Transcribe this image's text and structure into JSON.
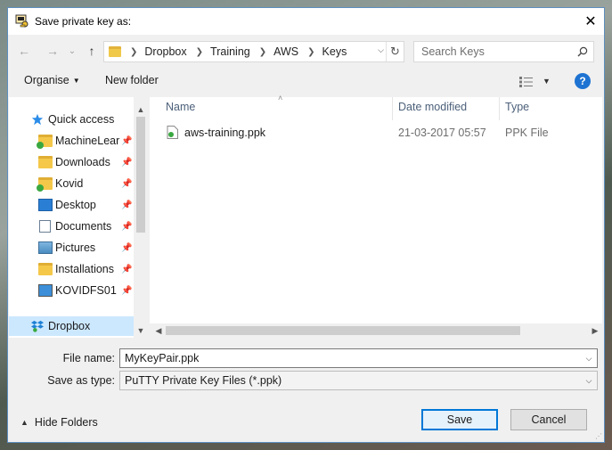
{
  "window": {
    "title": "Save private key as:",
    "close_glyph": "✕"
  },
  "nav": {
    "back_glyph": "←",
    "forward_glyph": "→",
    "recent_glyph": "⌄",
    "up_glyph": "↑",
    "breadcrumb": [
      "Dropbox",
      "Training",
      "AWS",
      "Keys"
    ],
    "search_placeholder": "Search Keys"
  },
  "toolbar": {
    "organise": "Organise",
    "new_folder": "New folder",
    "help": "?"
  },
  "sidebar": {
    "items": [
      {
        "label": "Quick access",
        "icon": "star-icon",
        "pinned": false
      },
      {
        "label": "MachineLearn",
        "icon": "folder-synced-icon",
        "pinned": true
      },
      {
        "label": "Downloads",
        "icon": "folder-icon",
        "pinned": true
      },
      {
        "label": "Kovid",
        "icon": "folder-synced-icon",
        "pinned": true
      },
      {
        "label": "Desktop",
        "icon": "desktop-icon",
        "pinned": true
      },
      {
        "label": "Documents",
        "icon": "documents-icon",
        "pinned": true
      },
      {
        "label": "Pictures",
        "icon": "pictures-icon",
        "pinned": true
      },
      {
        "label": "Installations",
        "icon": "folder-icon",
        "pinned": true
      },
      {
        "label": "KOVIDFS01",
        "icon": "computer-icon",
        "pinned": true
      },
      {
        "label": "Dropbox",
        "icon": "dropbox-icon",
        "pinned": false,
        "selected": true
      }
    ]
  },
  "files": {
    "columns": [
      "Name",
      "Date modified",
      "Type"
    ],
    "rows": [
      {
        "name": "aws-training.ppk",
        "date": "21-03-2017 05:57",
        "type": "PPK File"
      }
    ]
  },
  "form": {
    "file_name_label": "File name:",
    "file_name_value": "MyKeyPair.ppk",
    "save_type_label": "Save as type:",
    "save_type_value": "PuTTY Private Key Files (*.ppk)"
  },
  "footer": {
    "hide_folders": "Hide Folders",
    "save": "Save",
    "cancel": "Cancel"
  },
  "colors": {
    "accent": "#0078d7",
    "selected_bg": "#cce8ff",
    "help_blue": "#1e73d2"
  }
}
